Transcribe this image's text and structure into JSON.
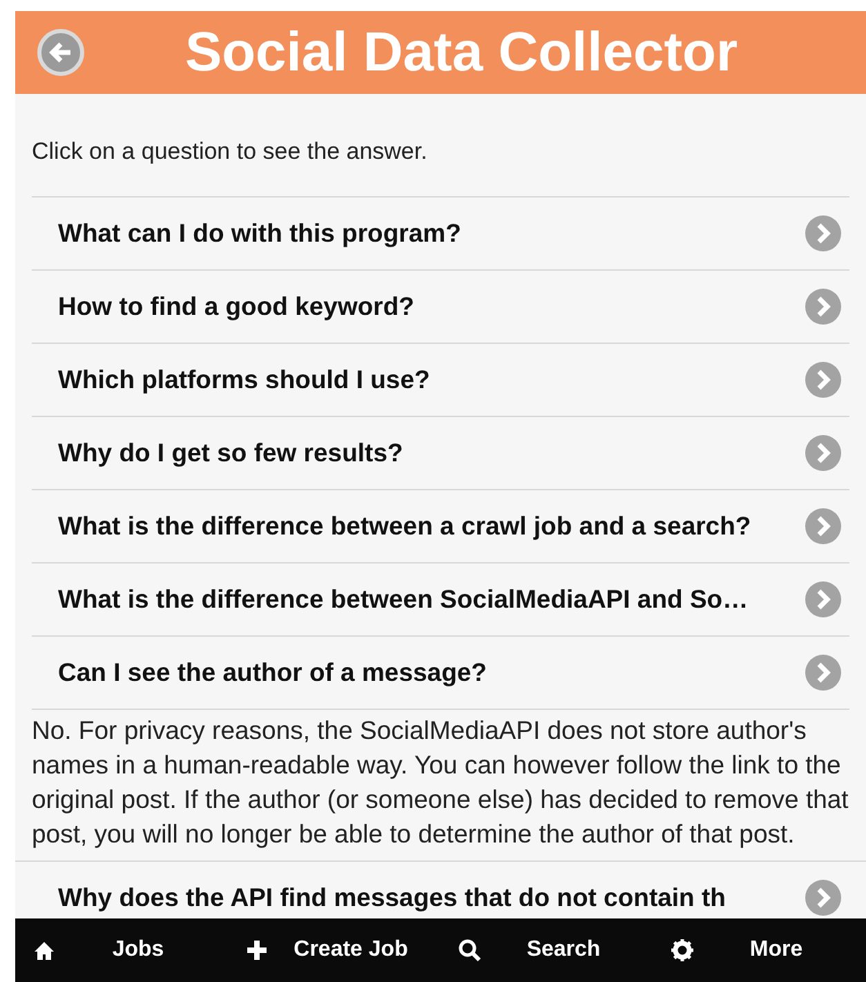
{
  "header": {
    "title": "Social Data Collector"
  },
  "intro": "Click on a question to see the answer.",
  "questions": [
    {
      "question": "What can I do with this program?"
    },
    {
      "question": "How to find a good keyword?"
    },
    {
      "question": "Which platforms should I use?"
    },
    {
      "question": "Why do I get so few results?"
    },
    {
      "question": "What is the difference between a crawl job and a search?"
    },
    {
      "question": "What is the difference between SocialMediaAPI and So…"
    },
    {
      "question": "Can I see the author of a message?",
      "answer": "No. For privacy reasons, the SocialMediaAPI does not store author's names in a human-readable way. You can however follow the link to the original post. If the author (or someone else) has decided to remove that post, you will no longer be able to determine the author of that post."
    },
    {
      "question": "Why does the API find messages that do not contain th"
    }
  ],
  "nav": [
    {
      "kind": "home",
      "label": "Jobs"
    },
    {
      "kind": "plus",
      "label": "Create Job"
    },
    {
      "kind": "search",
      "label": "Search"
    },
    {
      "kind": "gear",
      "label": "More"
    }
  ]
}
